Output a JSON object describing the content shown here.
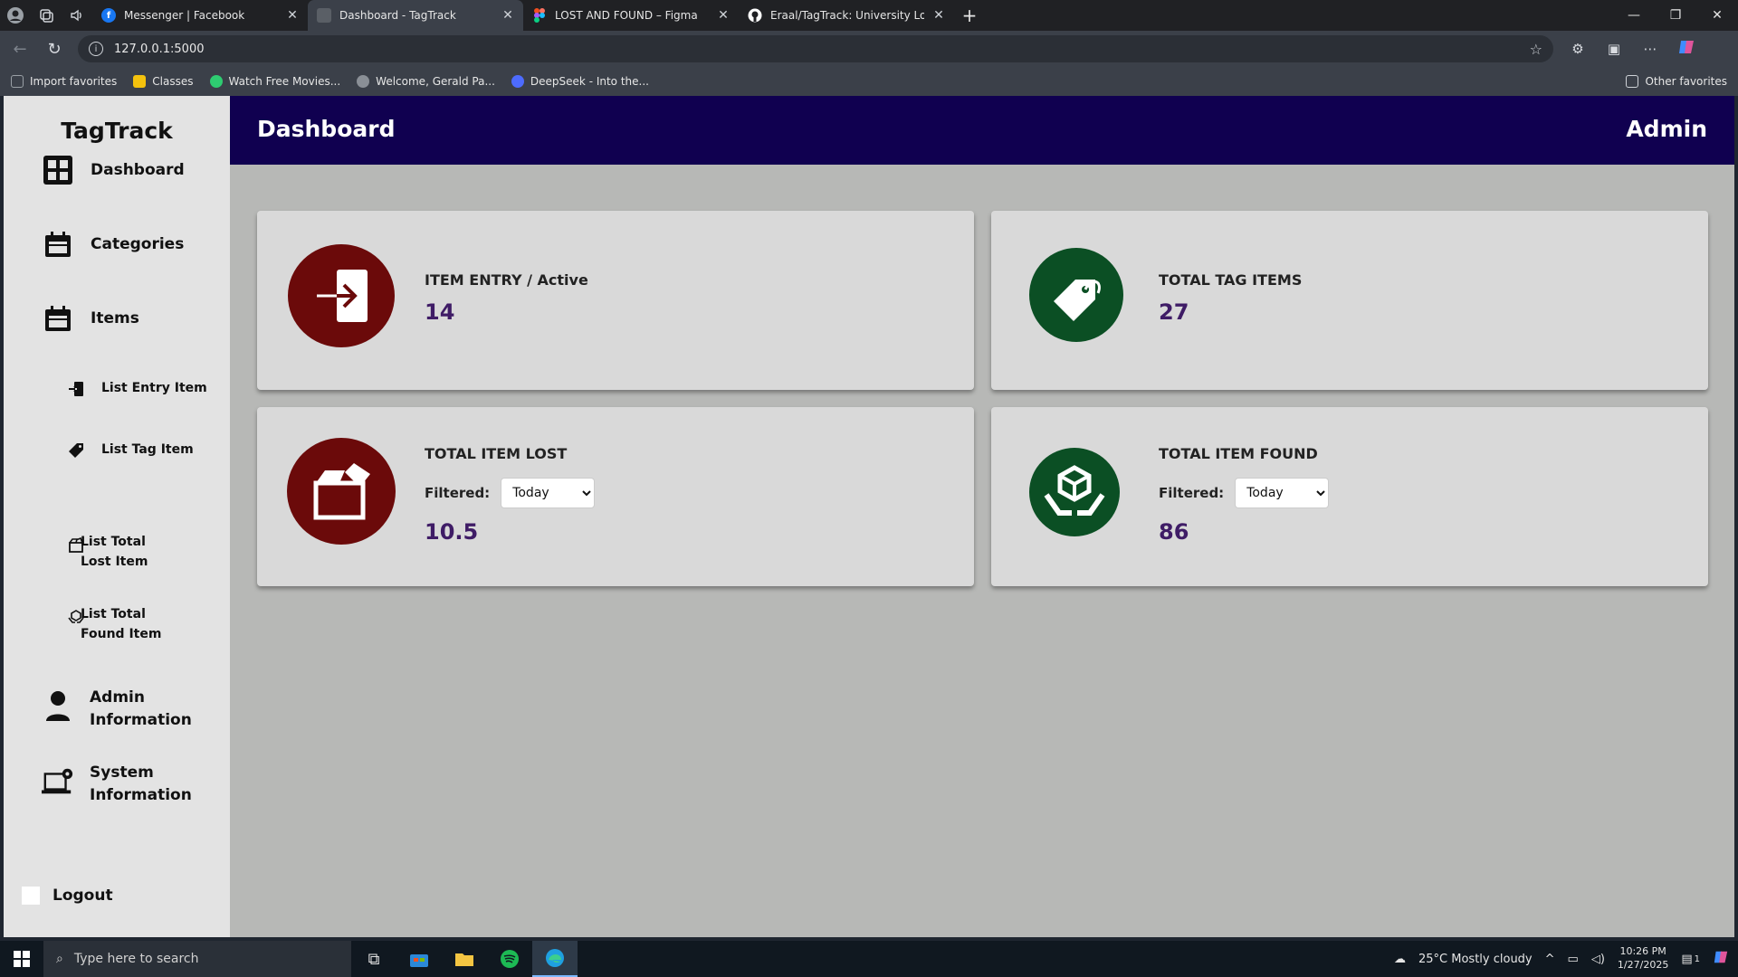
{
  "browser": {
    "tabs": [
      {
        "title": "Messenger | Facebook",
        "icon": "facebook-icon",
        "color": "#1877f2",
        "active": false
      },
      {
        "title": "Dashboard - TagTrack",
        "icon": "page-icon",
        "color": "#5a5f66",
        "active": true
      },
      {
        "title": "LOST AND FOUND – Figma",
        "icon": "figma-icon",
        "color": "#f24e1e",
        "active": false
      },
      {
        "title": "Eraal/TagTrack: University Lost an",
        "icon": "github-icon",
        "color": "#ffffff",
        "active": false
      }
    ],
    "url": "127.0.0.1:5000",
    "bookmarks": [
      {
        "label": "Import favorites",
        "icon": "import-icon",
        "color": "#9aa0a6"
      },
      {
        "label": "Classes",
        "icon": "classroom-icon",
        "color": "#f4c20d"
      },
      {
        "label": "Watch Free Movies...",
        "icon": "play-icon",
        "color": "#2ecc71"
      },
      {
        "label": "Welcome, Gerald Pa...",
        "icon": "globe-icon",
        "color": "#8a8f96"
      },
      {
        "label": "DeepSeek - Into the...",
        "icon": "deepseek-icon",
        "color": "#4d6bfe"
      }
    ],
    "other_favorites": "Other favorites"
  },
  "sidebar": {
    "brand": "TagTrack",
    "items": [
      {
        "label": "Dashboard",
        "icon": "dashboard-grid-icon"
      },
      {
        "label": "Categories",
        "icon": "calendar-folder-icon"
      },
      {
        "label": "Items",
        "icon": "calendar-folder-icon"
      }
    ],
    "sub_items": [
      {
        "label": "List Entry Item",
        "icon": "sign-in-icon"
      },
      {
        "label": "List Tag Item",
        "icon": "tag-icon"
      },
      {
        "label": "List Total Lost Item",
        "icon": "open-box-icon"
      },
      {
        "label": "List Total Found Item",
        "icon": "hands-box-icon"
      }
    ],
    "admin_info": "Admin Information",
    "system_info": "System Information",
    "logout": "Logout"
  },
  "header": {
    "title": "Dashboard",
    "user": "Admin"
  },
  "cards": {
    "entry": {
      "label": "ITEM ENTRY / Active",
      "value": "14",
      "icon": "sign-in-icon",
      "color": "#6b0a0a"
    },
    "tag": {
      "label": "TOTAL TAG ITEMS",
      "value": "27",
      "icon": "tag-icon",
      "color": "#0b4f24"
    },
    "lost": {
      "label": "TOTAL ITEM LOST",
      "filter_label": "Filtered:",
      "filter_value": "Today",
      "value": "10.5",
      "icon": "open-box-icon",
      "color": "#6b0a0a"
    },
    "found": {
      "label": "TOTAL ITEM FOUND",
      "filter_label": "Filtered:",
      "filter_value": "Today",
      "value": "86",
      "icon": "hands-box-icon",
      "color": "#0b4f24"
    }
  },
  "taskbar": {
    "search_placeholder": "Type here to search",
    "weather": "25°C  Mostly cloudy",
    "time": "10:26 PM",
    "date": "1/27/2025",
    "notification_count": "1"
  }
}
